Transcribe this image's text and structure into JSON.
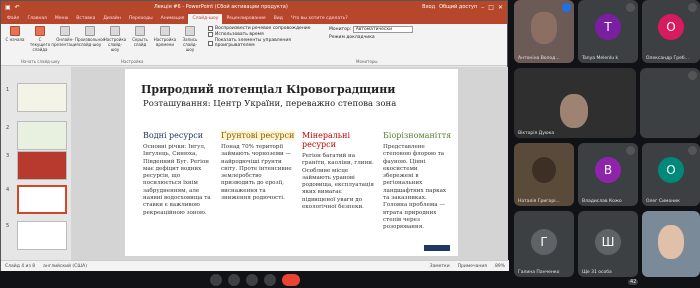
{
  "ppt": {
    "title": "Лекція #6 - PowerPoint (Сбой активации продукта)",
    "login": "Вход",
    "share": "Общий доступ",
    "tabs": [
      "Файл",
      "Главная",
      "Меню",
      "Вставка",
      "Дизайн",
      "Переходы",
      "Анимация",
      "Слайд-шоу",
      "Рецензирование",
      "Вид",
      "Что вы хотите сделать?"
    ],
    "ribbon_buttons": [
      "С начала",
      "С текущего слайда",
      "Онлайн-презентация",
      "Произвольное слайд-шоу",
      "Настройка слайд-шоу",
      "Скрыть слайд",
      "Настройка времени",
      "Запись слайд-шоу"
    ],
    "checkboxes": [
      "Воспроизвести речевое сопровождение",
      "Использовать время",
      "Показать элементы управления проигрывателем"
    ],
    "monitor_label": "Монитор:",
    "monitor_value": "Автоматически",
    "presenter_view": "Режим докладчика",
    "group_labels": [
      "Начать слайд-шоу",
      "Настройка",
      "Мониторы"
    ],
    "slide_numbers": [
      "1",
      "2",
      "3",
      "4",
      "5"
    ],
    "status_left": "Слайд 4 из 8",
    "status_lang": "английский (США)",
    "status_notes": "Заметки",
    "status_comments": "Примечания",
    "zoom": "89%",
    "slide": {
      "title": "Природний потенціал Кіровоградщини",
      "subtitle": "Розташування: Центр України, переважно степова зона",
      "columns": [
        {
          "heading": "Водні ресурси",
          "color": "#1f3864",
          "body": "Основні річки: Інгул, Інгулець, Синюха, Південний Буг. Регіон має дефіцит водних ресурсів, що посилюється їхнім забрудненням, але наявні водосховища та ставки є важливою рекреаційною зоною."
        },
        {
          "heading": "Ґрунтові ресурси",
          "color": "#7f6000",
          "body": "Понад 70% території займають чорноземи — найродючіші ґрунти світу. Проте інтенсивне землеробство призводить до ерозії, виснаження та зниження родючості."
        },
        {
          "heading": "Мінеральні ресурси",
          "color": "#c00000",
          "body": "Регіон багатий на граніти, каоліни, глини. Особливе місце займають уранові родовища, експлуатація яких вимагає підвищеної уваги до екологічної безпеки."
        },
        {
          "heading": "Біорізноманіття",
          "color": "#548235",
          "body": "Представлене степовою флорою та фауною. Цінні екосистеми збережені в регіональних ландшафтних парках та заказниках. Головна проблема — втрата природних степів через розорювання."
        }
      ]
    }
  },
  "participants": [
    {
      "name": "Антоніна Волод...",
      "initial": "",
      "color": "#6b5a55"
    },
    {
      "name": "Tanya Melenlu k",
      "initial": "T",
      "color": "#7b1fa2"
    },
    {
      "name": "Олександр Греб...",
      "initial": "О",
      "color": "#d81b60"
    },
    {
      "name": "Вікторія Дуюка",
      "initial": "",
      "color": "#3a3a3a"
    },
    {
      "name": "",
      "initial": "",
      "color": "#333"
    },
    {
      "name": "Наталія Григорі...",
      "initial": "",
      "color": "#5a4a3a"
    },
    {
      "name": "Владислав Кожо",
      "initial": "В",
      "color": "#8e24aa"
    },
    {
      "name": "Олег Симоник",
      "initial": "О",
      "color": "#00897b"
    },
    {
      "name": "Галина Панченко",
      "initial": "Г",
      "color": "#5f6368"
    },
    {
      "name": "Ще 31 особа",
      "initial": "Ш",
      "color": "#5f6368"
    },
    {
      "name": "",
      "initial": "",
      "color": "#7a8a99"
    }
  ],
  "more_count": "42"
}
